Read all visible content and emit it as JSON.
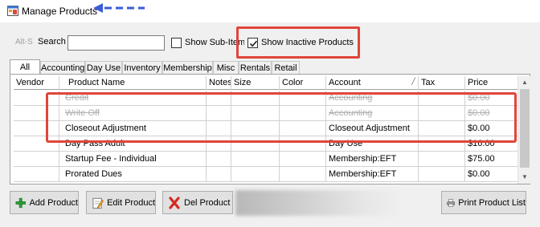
{
  "window": {
    "title": "Manage Products",
    "icon": "app-window-icon"
  },
  "annotation_colors": {
    "arrow": "#3a5bd9",
    "highlight": "#e0453b"
  },
  "toolbar": {
    "alts_label": "Alt-S",
    "search_label": "Search",
    "search_value": "",
    "show_sub_items_label": "Show Sub-Items",
    "show_sub_items_checked": false,
    "show_inactive_label": "Show Inactive Products",
    "show_inactive_checked": true
  },
  "tabs": [
    {
      "label": "All",
      "active": true
    },
    {
      "label": "Accounting",
      "active": false
    },
    {
      "label": "Day Use",
      "active": false
    },
    {
      "label": "Inventory",
      "active": false
    },
    {
      "label": "Membership",
      "active": false
    },
    {
      "label": "Misc",
      "active": false
    },
    {
      "label": "Rentals",
      "active": false
    },
    {
      "label": "Retail",
      "active": false
    }
  ],
  "grid": {
    "columns": [
      "Vendor",
      "Product Name",
      "Notes",
      "Size",
      "Color",
      "Account",
      "Tax",
      "Price"
    ],
    "rows": [
      {
        "vendor": "",
        "product_name": "Credit",
        "notes": "",
        "size": "",
        "color": "",
        "account": "Accounting",
        "tax": "",
        "price": "$0.00",
        "inactive": true
      },
      {
        "vendor": "",
        "product_name": "Write Off",
        "notes": "",
        "size": "",
        "color": "",
        "account": "Accounting",
        "tax": "",
        "price": "$0.00",
        "inactive": true
      },
      {
        "vendor": "",
        "product_name": "Closeout Adjustment",
        "notes": "",
        "size": "",
        "color": "",
        "account": "Closeout Adjustment",
        "tax": "",
        "price": "$0.00",
        "inactive": false
      },
      {
        "vendor": "",
        "product_name": "Day Pass Adult",
        "notes": "",
        "size": "",
        "color": "",
        "account": "Day Use",
        "tax": "",
        "price": "$16.00",
        "inactive": false
      },
      {
        "vendor": "",
        "product_name": "Startup Fee - Individual",
        "notes": "",
        "size": "",
        "color": "",
        "account": "Membership:EFT",
        "tax": "",
        "price": "$75.00",
        "inactive": false
      },
      {
        "vendor": "",
        "product_name": "Prorated Dues",
        "notes": "",
        "size": "",
        "color": "",
        "account": "Membership:EFT",
        "tax": "",
        "price": "$0.00",
        "inactive": false
      }
    ]
  },
  "buttons": {
    "add": "Add Product",
    "edit": "Edit Product",
    "del": "Del Product",
    "print": "Print Product List"
  }
}
